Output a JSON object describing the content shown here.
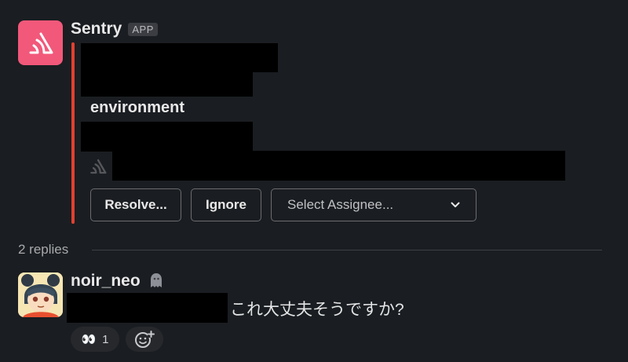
{
  "message": {
    "sender": "Sentry",
    "badge": "APP",
    "field_title": "environment",
    "buttons": {
      "resolve": "Resolve...",
      "ignore": "Ignore"
    },
    "assignee_select": {
      "placeholder": "Select Assignee..."
    },
    "accent_color": "#e2412f",
    "avatar_color": "#f2587a"
  },
  "thread": {
    "replies_label": "2 replies"
  },
  "reply": {
    "user": "noir_neo",
    "text": "これ大丈夫そうですか?",
    "reactions": [
      {
        "emoji": "👀",
        "count": "1"
      }
    ]
  }
}
